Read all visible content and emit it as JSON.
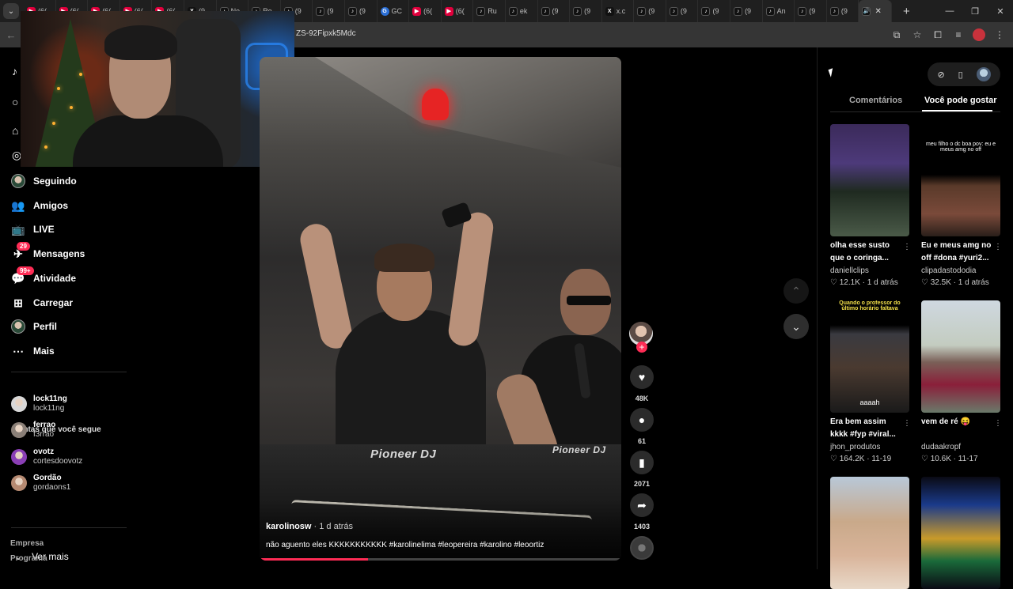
{
  "browser": {
    "tabs": [
      {
        "fav": "yt",
        "text": "(6("
      },
      {
        "fav": "yt",
        "text": "(6("
      },
      {
        "fav": "yt",
        "text": "(6("
      },
      {
        "fav": "yt",
        "text": "(6("
      },
      {
        "fav": "yt",
        "text": "(6("
      },
      {
        "fav": "x",
        "text": "(9"
      },
      {
        "fav": "tt",
        "text": "Ne"
      },
      {
        "fav": "tt",
        "text": "Ro"
      },
      {
        "fav": "tt",
        "text": "(9"
      },
      {
        "fav": "tt",
        "text": "(9"
      },
      {
        "fav": "tt",
        "text": "(9"
      },
      {
        "fav": "gc",
        "text": "GC"
      },
      {
        "fav": "yt",
        "text": "(6("
      },
      {
        "fav": "yt",
        "text": "(6("
      },
      {
        "fav": "tt",
        "text": "Ru"
      },
      {
        "fav": "tt",
        "text": "ek"
      },
      {
        "fav": "tt",
        "text": "(9"
      },
      {
        "fav": "tt",
        "text": "(9"
      },
      {
        "fav": "x",
        "text": "x.c"
      },
      {
        "fav": "tt",
        "text": "(9"
      },
      {
        "fav": "tt",
        "text": "(9"
      },
      {
        "fav": "tt",
        "text": "(9"
      },
      {
        "fav": "tt",
        "text": "(9"
      },
      {
        "fav": "tt",
        "text": "An"
      },
      {
        "fav": "tt",
        "text": "(9"
      },
      {
        "fav": "tt",
        "text": "(9"
      }
    ],
    "new_tab": "+",
    "url": "ZS-92Fipxk5Mdc"
  },
  "sidebar": {
    "nav": [
      {
        "label": "Seguindo",
        "icon": "following-avatar-icon",
        "glyph": "",
        "badge": ""
      },
      {
        "label": "Amigos",
        "icon": "friends-icon",
        "glyph": "👥",
        "badge": ""
      },
      {
        "label": "LIVE",
        "icon": "live-icon",
        "glyph": "📺",
        "badge": ""
      },
      {
        "label": "Mensagens",
        "icon": "messages-icon",
        "glyph": "✈",
        "badge": "29"
      },
      {
        "label": "Atividade",
        "icon": "activity-icon",
        "glyph": "💬",
        "badge": "99+"
      },
      {
        "label": "Carregar",
        "icon": "upload-icon",
        "glyph": "⊞",
        "badge": ""
      },
      {
        "label": "Perfil",
        "icon": "profile-avatar-icon",
        "glyph": "",
        "badge": ""
      },
      {
        "label": "Mais",
        "icon": "more-dots-icon",
        "glyph": "⋯",
        "badge": ""
      }
    ],
    "following_title": "Contas que você segue",
    "following": [
      {
        "name": "lock11ng",
        "handle": "lock11ng",
        "color": "#d8d8d8"
      },
      {
        "name": "ferrao",
        "handle": "f3rrao",
        "color": "#8a7f77"
      },
      {
        "name": "ovotz",
        "handle": "cortesdoovotz",
        "color": "#8a3fb5"
      },
      {
        "name": "Gordão",
        "handle": "gordaons1",
        "color": "#b68a72"
      }
    ],
    "see_more": "Ver mais",
    "footer": [
      "Empresa",
      "Programa"
    ]
  },
  "video": {
    "author": "karolinosw",
    "time": " · 1 d atrás",
    "caption": "não aguento eles KKKKKKKKKKK #karolinelima #leopereira #karolino #leoortiz",
    "deck_label": "Pioneer DJ",
    "progress": 0.3
  },
  "actions": {
    "likes": "48K",
    "comments": "61",
    "saves": "2071",
    "shares": "1403"
  },
  "right_panel": {
    "tabs": [
      "Comentários",
      "Você pode gostar"
    ],
    "cards": [
      {
        "title": "olha esse susto que o coringa...",
        "author": "daniellclips",
        "likes": "12.1K",
        "time": "1 d atrás",
        "overlay": ""
      },
      {
        "title": "Eu e meus amg no off #dona #yuri2...",
        "author": "clipadastododia",
        "likes": "32.5K",
        "time": "1 d atrás",
        "overlay": "meu filho o dc boa pov: eu e meus amg no off"
      },
      {
        "title": "Era bem assim kkkk #fyp #viral...",
        "author": "jhon_produtos",
        "likes": "164.2K",
        "time": "11-19",
        "overlay": "Quando o professor do último horário faltava"
      },
      {
        "title": "vem de ré 😝",
        "author": "dudaakropf",
        "likes": "10.6K",
        "time": "11-17",
        "overlay": ""
      },
      {
        "title": "",
        "author": "",
        "likes": "",
        "time": "",
        "overlay": ""
      },
      {
        "title": "",
        "author": "",
        "likes": "",
        "time": "",
        "overlay": ""
      }
    ],
    "card3_inner": "aaaah"
  }
}
